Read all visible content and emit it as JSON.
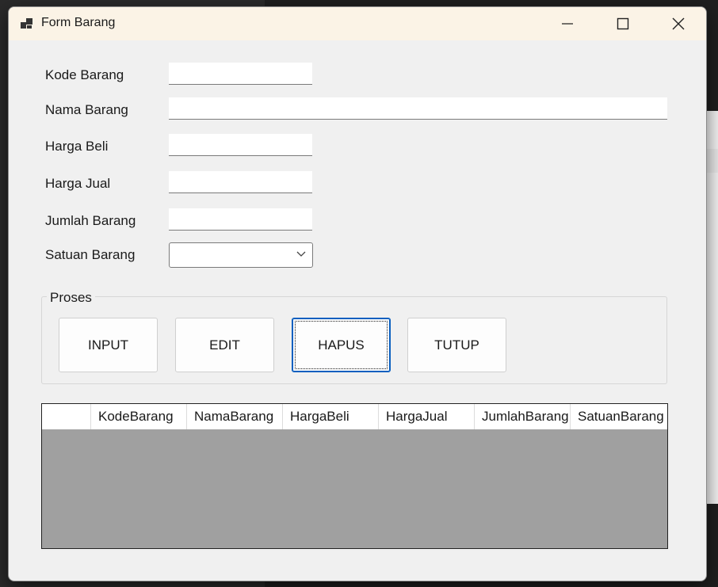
{
  "window": {
    "title": "Form Barang",
    "controls": [
      "minimize-icon",
      "maximize-icon",
      "close-icon"
    ]
  },
  "form": {
    "fields": [
      {
        "label": "Kode Barang",
        "value": "",
        "type": "text"
      },
      {
        "label": "Nama Barang",
        "value": "",
        "type": "text"
      },
      {
        "label": "Harga Beli",
        "value": "",
        "type": "text"
      },
      {
        "label": "Harga Jual",
        "value": "",
        "type": "text"
      },
      {
        "label": "Jumlah Barang",
        "value": "",
        "type": "text"
      },
      {
        "label": "Satuan Barang",
        "value": "",
        "type": "combo"
      }
    ]
  },
  "proses": {
    "title": "Proses",
    "buttons": [
      "INPUT",
      "EDIT",
      "HAPUS",
      "TUTUP"
    ],
    "focused": "HAPUS"
  },
  "grid": {
    "columns": [
      "KodeBarang",
      "NamaBarang",
      "HargaBeli",
      "HargaJual",
      "JumlahBarang",
      "SatuanBarang"
    ],
    "rows": []
  },
  "colors": {
    "titlebar": "#fbf3e6",
    "window_bg": "#f0f0f0",
    "grid_bg": "#a0a0a0",
    "focus_border": "#0a5fbf"
  }
}
